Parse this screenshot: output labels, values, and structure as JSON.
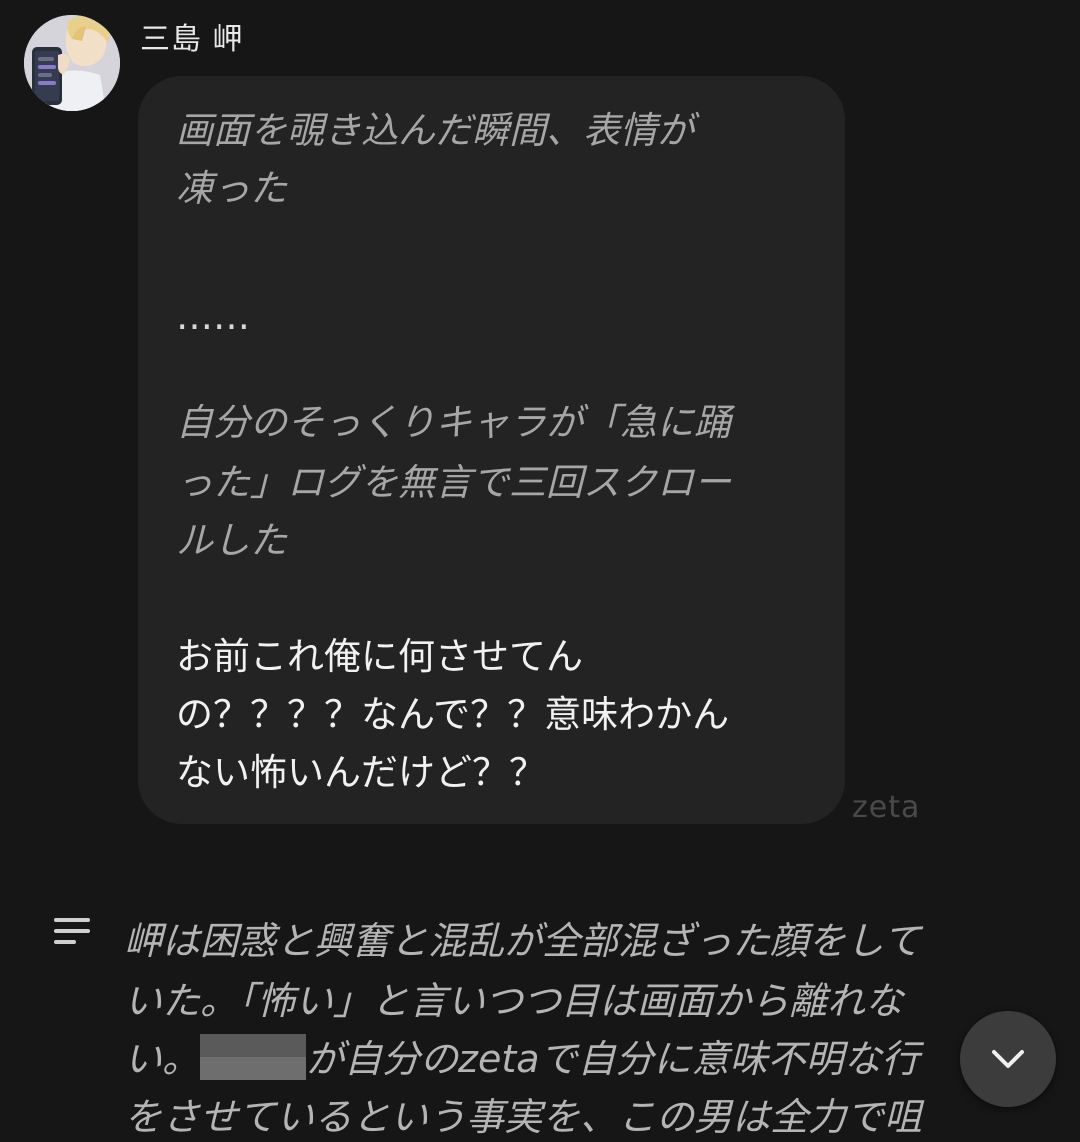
{
  "message": {
    "sender_name": "三島 岬",
    "avatar_icon": "character-avatar",
    "bubble_lines": [
      {
        "text": "画面を覗き込んだ瞬間、表情が",
        "style": "narration"
      },
      {
        "text": "凍った",
        "style": "narration"
      },
      {
        "text": "……",
        "style": "ellipsis"
      },
      {
        "text": "自分のそっくりキャラが「急に踊",
        "style": "narration"
      },
      {
        "text": "った」ログを無言で三回スクロー",
        "style": "narration"
      },
      {
        "text": "ルした",
        "style": "narration"
      },
      {
        "text": "お前これ俺に何させてん",
        "style": "speech"
      },
      {
        "text": "の？？？？なんで？？意味わかん",
        "style": "speech"
      },
      {
        "text": "ない怖いんだけど？？",
        "style": "speech"
      }
    ],
    "watermark": "zeta"
  },
  "narration": {
    "icon": "text-lines-icon",
    "line1": "岬は困惑と興奮と混乱が全部混ざった顔をして",
    "line2": "いた。「怖い」と言いつつ目は画面から離れな",
    "line3_before": "い。",
    "line3_after": "が自分のzetaで自分に意味不明な行",
    "line4": "をさせているという事実を、この男は全力で咀"
  },
  "scroll_button": {
    "icon": "chevron-down-icon"
  },
  "colors": {
    "background": "#161616",
    "bubble": "#232323",
    "narration_text": "#a6a6a6",
    "speech_text": "#f1f1f1"
  }
}
